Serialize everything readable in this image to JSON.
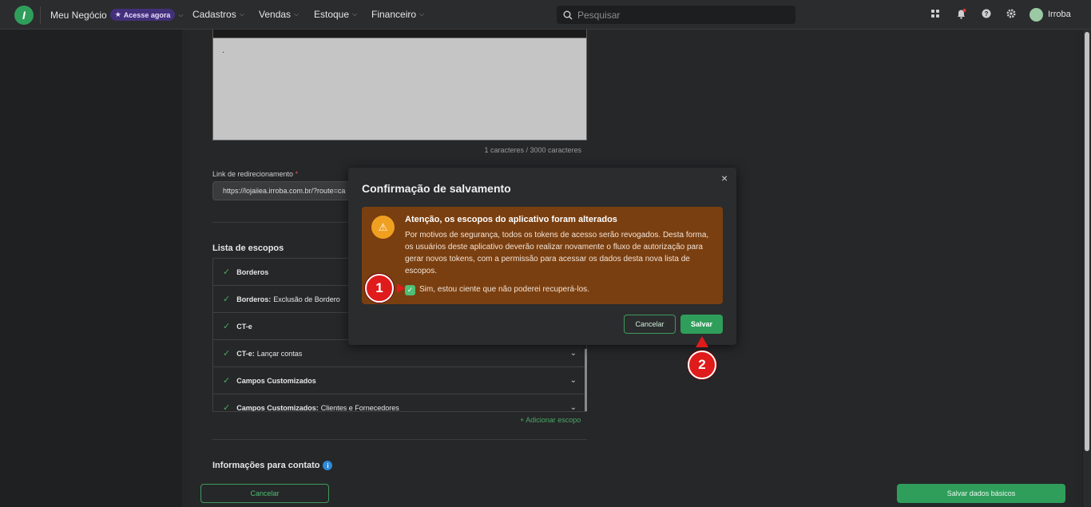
{
  "topbar": {
    "logo_letter": "I",
    "business": "Meu Negócio",
    "badge": "Acesse agora",
    "menus": [
      "Cadastros",
      "Vendas",
      "Estoque",
      "Financeiro"
    ],
    "search_placeholder": "Pesquisar",
    "user": "Irroba"
  },
  "page": {
    "textarea_value": ".",
    "char_counter": "1 caracteres / 3000 caracteres",
    "redirect_label": "Link de redirecionamento",
    "redirect_required": "*",
    "redirect_value": "https://lojaiiea.irroba.com.br/?route=ca",
    "scopes_title": "Lista de escopos",
    "scopes": [
      {
        "name": "Borderos",
        "detail": ""
      },
      {
        "name": "Borderos:",
        "detail": "Exclusão de Bordero"
      },
      {
        "name": "CT-e",
        "detail": ""
      },
      {
        "name": "CT-e:",
        "detail": "Lançar contas"
      },
      {
        "name": "Campos Customizados",
        "detail": ""
      },
      {
        "name": "Campos Customizados:",
        "detail": "Clientes e Fornecedores"
      }
    ],
    "add_scope": "+ Adicionar escopo",
    "contact_title": "Informações para contato",
    "cancel": "Cancelar",
    "save_basic": "Salvar dados básicos"
  },
  "modal": {
    "title": "Confirmação de salvamento",
    "close": "×",
    "alert_title": "Atenção, os escopos do aplicativo foram alterados",
    "alert_text": "Por motivos de segurança, todos os tokens de acesso serão revogados. Desta forma, os usuários deste aplicativo deverão realizar novamente o fluxo de autorização para gerar novos tokens, com a permissão para acessar os dados desta nova lista de escopos.",
    "checkbox_label": "Sim, estou ciente que não poderei recuperá-los.",
    "checkbox_checked": true,
    "cancel": "Cancelar",
    "save": "Salvar"
  },
  "markers": [
    "1",
    "2"
  ],
  "colors": {
    "accent_green": "#2f9e5a",
    "alert_brown": "#7a3f10",
    "warning_orange": "#f0a020",
    "marker_red": "#e01b1b"
  }
}
